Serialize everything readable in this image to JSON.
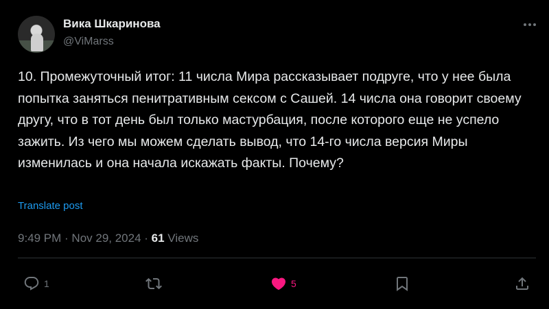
{
  "author": {
    "name": "Вика Шкаринова",
    "handle": "@ViMarss"
  },
  "post": {
    "text": "10. Промежуточный итог: 11 числа Мира рассказывает подруге, что у нее была попытка заняться пенитративным сексом с Сашей. 14 числа она говорит своему другу, что в тот день был только мастурбация, после которого еще не успело зажить. Из чего мы можем сделать вывод, что 14-го числа версия Миры изменилась и она начала искажать факты. Почему?",
    "translate_label": "Translate post",
    "timestamp": "9:49 PM · Nov 29, 2024 · ",
    "views_count": "61",
    "views_label": " Views"
  },
  "actions": {
    "reply_count": "1",
    "like_count": "5"
  },
  "colors": {
    "background": "#000000",
    "text": "#e7e9ea",
    "muted": "#71767b",
    "link": "#1d9bf0",
    "like": "#f91880",
    "divider": "#2f3336"
  },
  "icons": {
    "more": "more-icon",
    "reply": "reply-icon",
    "retweet": "retweet-icon",
    "like": "heart-icon",
    "bookmark": "bookmark-icon",
    "share": "share-icon"
  }
}
